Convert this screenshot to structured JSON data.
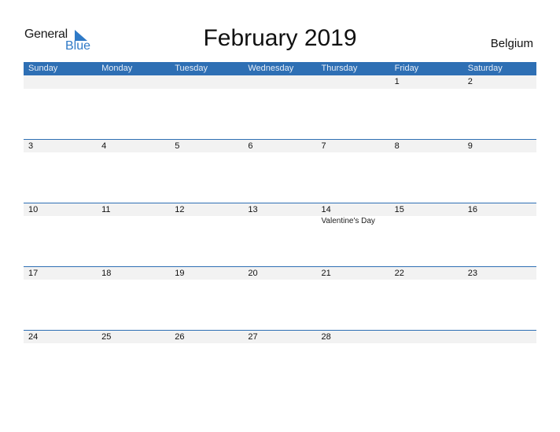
{
  "logo": {
    "line1": "General",
    "line2": "Blue"
  },
  "title": "February 2019",
  "country": "Belgium",
  "colors": {
    "accent": "#2e6fb4",
    "row_bg": "#f2f2f2"
  },
  "weekdays": [
    "Sunday",
    "Monday",
    "Tuesday",
    "Wednesday",
    "Thursday",
    "Friday",
    "Saturday"
  ],
  "weeks": [
    {
      "days": [
        "",
        "",
        "",
        "",
        "",
        "1",
        "2"
      ],
      "events": [
        "",
        "",
        "",
        "",
        "",
        "",
        ""
      ]
    },
    {
      "days": [
        "3",
        "4",
        "5",
        "6",
        "7",
        "8",
        "9"
      ],
      "events": [
        "",
        "",
        "",
        "",
        "",
        "",
        ""
      ]
    },
    {
      "days": [
        "10",
        "11",
        "12",
        "13",
        "14",
        "15",
        "16"
      ],
      "events": [
        "",
        "",
        "",
        "",
        "Valentine's Day",
        "",
        ""
      ]
    },
    {
      "days": [
        "17",
        "18",
        "19",
        "20",
        "21",
        "22",
        "23"
      ],
      "events": [
        "",
        "",
        "",
        "",
        "",
        "",
        ""
      ]
    },
    {
      "days": [
        "24",
        "25",
        "26",
        "27",
        "28",
        "",
        ""
      ],
      "events": [
        "",
        "",
        "",
        "",
        "",
        "",
        ""
      ]
    }
  ]
}
